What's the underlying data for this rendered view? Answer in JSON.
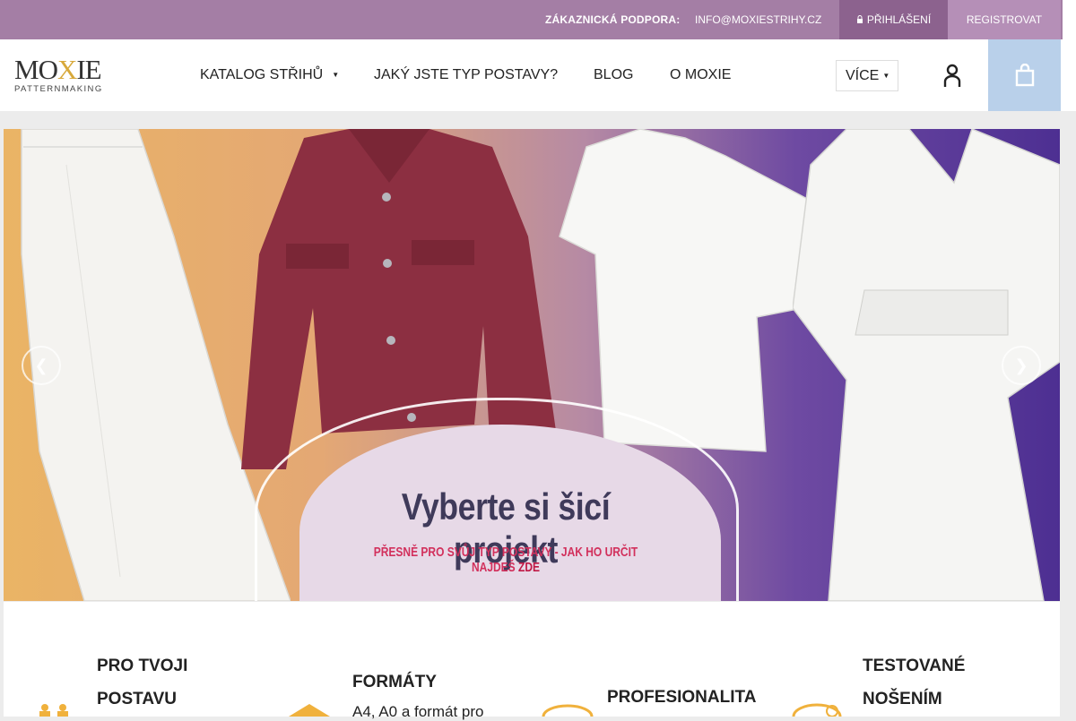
{
  "topbar": {
    "support_label": "ZÁKAZNICKÁ PODPORA:",
    "email": "INFO@MOXIESTRIHY.CZ",
    "login_icon": "login-icon",
    "login_label": "PŘIHLÁŠENÍ",
    "register_label": "REGISTROVAT"
  },
  "logo": {
    "main_left": "MO",
    "main_x": "X",
    "main_right": "IE",
    "sub": "PATTERNMAKING"
  },
  "nav": {
    "items": [
      {
        "label": "KATALOG STŘIHŮ",
        "has_dropdown": true
      },
      {
        "label": "JAKÝ JSTE TYP POSTAVY?"
      },
      {
        "label": "BLOG"
      },
      {
        "label": "O MOXIE"
      }
    ],
    "more_label": "VÍCE",
    "user_icon": "user-icon",
    "cart_icon": "cart-icon",
    "cart_color": "#b9d0ea"
  },
  "banner": {
    "title": "Vyberte si šicí projekt",
    "subtitle_main": "PŘESNĚ PRO SVŮJ TYP POSTAVY - JAK HO URČIT NAJDEŠ",
    "subtitle_link": "ZDE",
    "prev_icon": "chevron-left-icon",
    "next_icon": "chevron-right-icon"
  },
  "features": [
    {
      "title_line1": "PRO TVOJI",
      "title_line2": "POSTAVU",
      "icon": "figures-icon"
    },
    {
      "title": "FORMÁTY",
      "desc": "A4, A0 a formát pro",
      "icon": "layers-icon"
    },
    {
      "title": "PROFESIONALITA",
      "icon": "measuring-tape-icon"
    },
    {
      "title_line1": "TESTOVANÉ",
      "title_line2": "NOŠENÍM",
      "icon": "info-icon"
    }
  ],
  "colors": {
    "topbar": "#a47ea5",
    "login_bg": "#8c628e",
    "register_bg": "#b58fb7",
    "accent_icon": "#f0b13c"
  }
}
